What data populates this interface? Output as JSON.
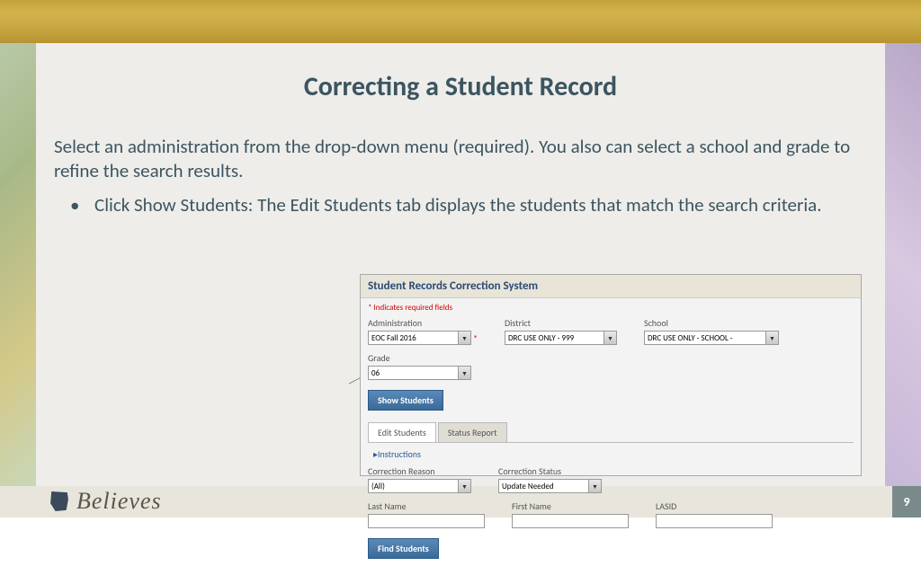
{
  "slide": {
    "title": "Correcting a Student Record",
    "intro": "Select an administration from the drop-down menu (required). You also can select a school and grade to refine the search results.",
    "bullet1": "Click Show Students: The Edit Students tab displays the students that match the search criteria."
  },
  "screenshot": {
    "title": "Student Records Correction System",
    "required_note": "* Indicates required fields",
    "fields": {
      "admin_label": "Administration",
      "admin_value": "EOC Fall 2016",
      "district_label": "District",
      "district_value": "DRC USE ONLY - 999",
      "school_label": "School",
      "school_value": "DRC USE ONLY - SCHOOL -",
      "grade_label": "Grade",
      "grade_value": "06"
    },
    "show_btn": "Show Students",
    "tabs": {
      "edit": "Edit Students",
      "report": "Status Report"
    },
    "instructions": "▸Instructions",
    "filters": {
      "reason_label": "Correction Reason",
      "reason_value": "(All)",
      "status_label": "Correction Status",
      "status_value": "Update Needed",
      "lastname_label": "Last Name",
      "firstname_label": "First Name",
      "lasid_label": "LASID"
    },
    "find_btn": "Find Students"
  },
  "footer": {
    "brand": "Believes",
    "page": "9"
  }
}
